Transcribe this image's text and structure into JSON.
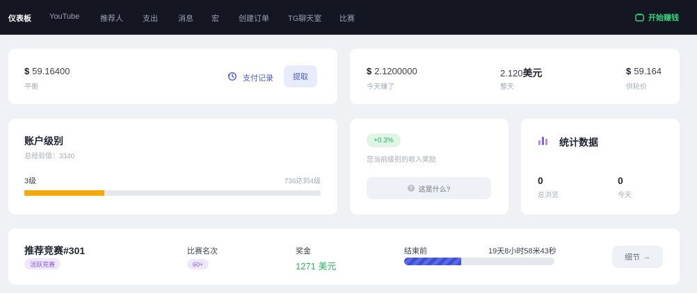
{
  "nav": {
    "items": [
      {
        "label": "仪表板",
        "active": true
      },
      {
        "label": "YouTube",
        "active": false
      },
      {
        "label": "推荐人",
        "active": false
      },
      {
        "label": "支出",
        "active": false
      },
      {
        "label": "消息",
        "active": false
      },
      {
        "label": "宏",
        "active": false
      },
      {
        "label": "创建订单",
        "active": false
      },
      {
        "label": "TG聊天室",
        "active": false
      },
      {
        "label": "比赛",
        "active": false
      }
    ],
    "earn_label": "开始赚钱",
    "earn_icon": "wallet-icon"
  },
  "balance_card": {
    "currency": "$",
    "amount": "59.16400",
    "label": "平衡",
    "history_icon": "history-icon",
    "history_label": "支付记录",
    "withdraw_label": "提取"
  },
  "earnings_card": {
    "today_currency": "$",
    "today_amount": "2.1200000",
    "today_label": "今天赚了",
    "total_amount": "2.120",
    "total_unit": "美元",
    "total_label": "整天",
    "turnover_currency": "$",
    "turnover_amount": "59.164",
    "turnover_label": "供轮价"
  },
  "level_card": {
    "title": "账户级别",
    "exp_label": "总经验值：3340",
    "level": "3级",
    "next_text": "736达到4级",
    "progress": 0.27
  },
  "reward_card": {
    "badge": "+0.3%",
    "description": "您当前级别的收入奖励",
    "help_label": "这是什么?"
  },
  "stats_card": {
    "icon": "bar-chart-icon",
    "title": "统计数据",
    "total_views_value": "0",
    "total_views_label": "总浏览",
    "today_value": "0",
    "today_label": "今天"
  },
  "contest_card": {
    "title": "推荐竞赛#301",
    "badge": "活跃竞赛",
    "rank_label": "比赛名次",
    "rank_badge": "60+",
    "prize_label": "奖金",
    "prize_value": "1271 美元",
    "ends_label": "结束前",
    "countdown": "19天8小时58米43秒",
    "progress": 0.38,
    "details_label": "细节",
    "details_arrow": "→"
  },
  "colors": {
    "nav_bg": "#141722",
    "accent_blue": "#4a5ad8",
    "accent_green": "#34d27b",
    "progress_orange": "#f5a70c"
  }
}
